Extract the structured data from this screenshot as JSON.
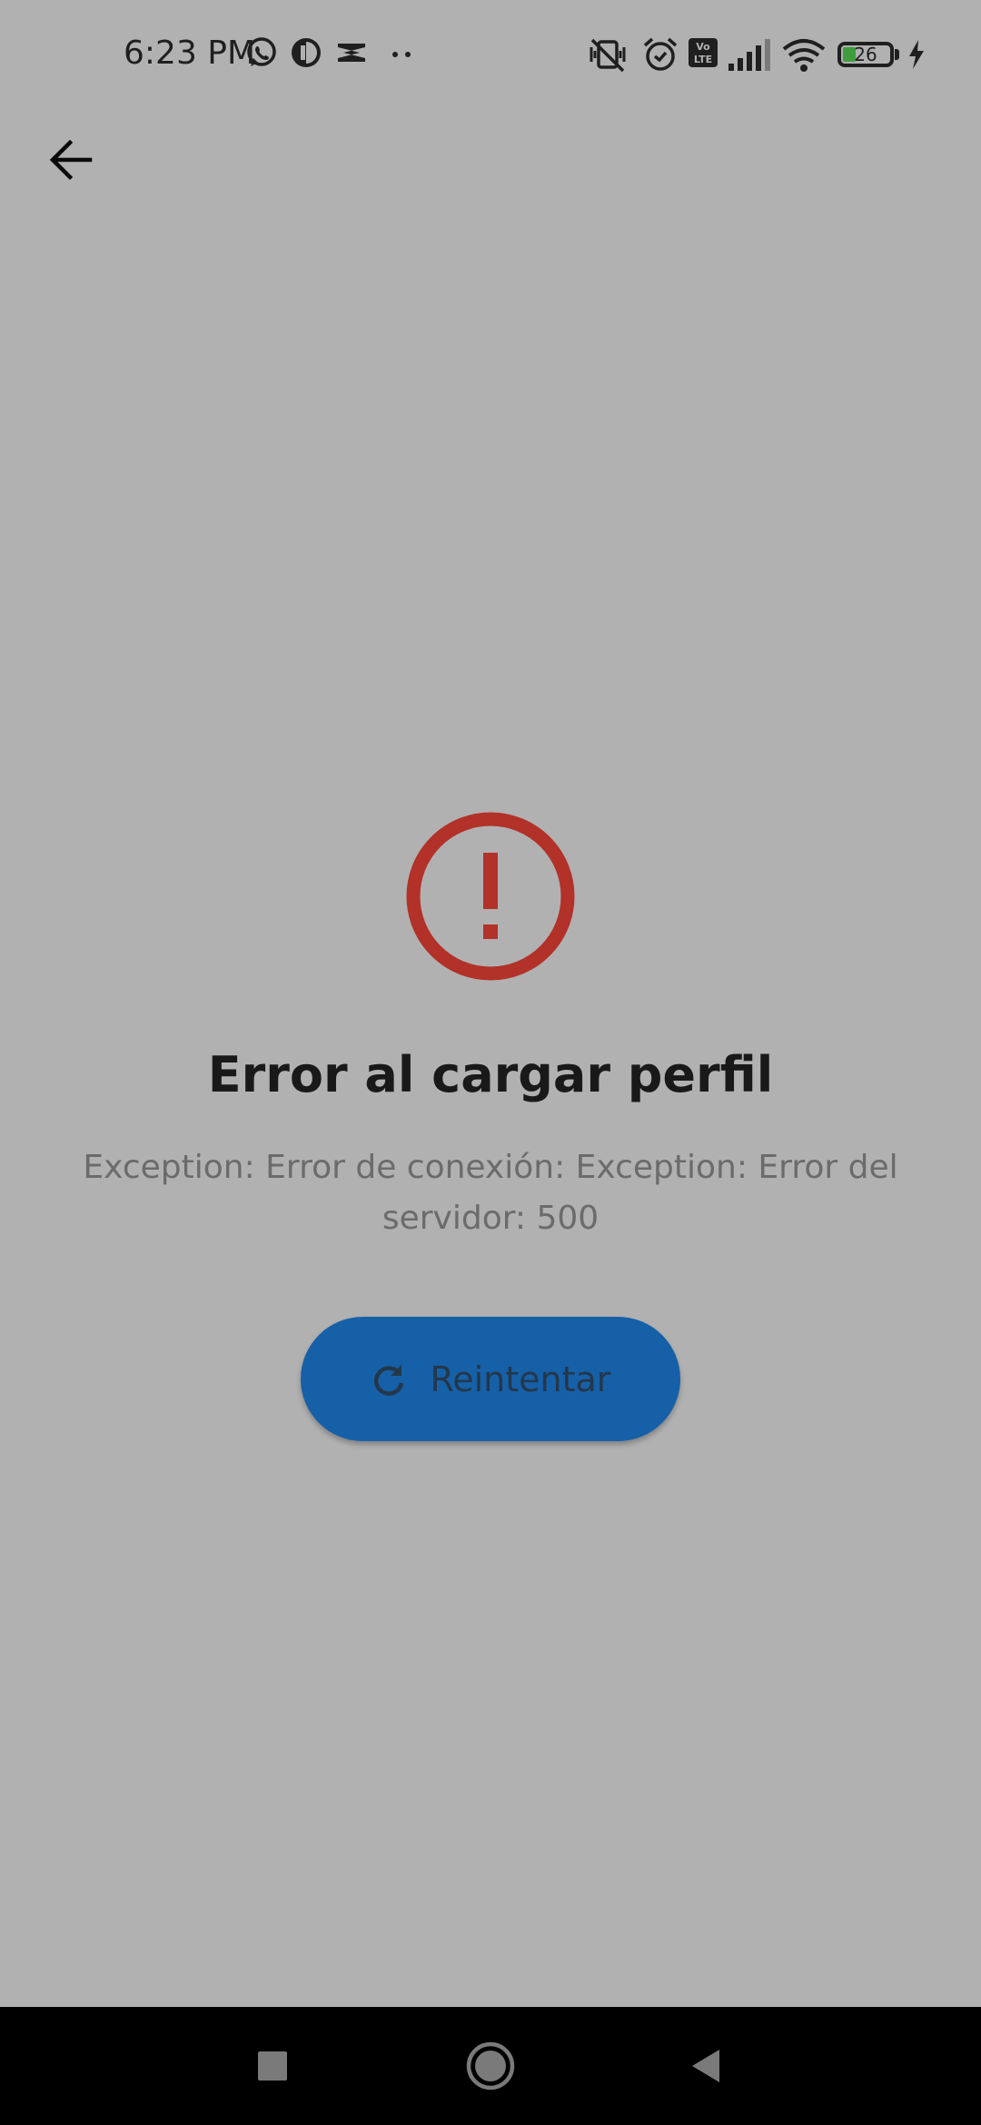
{
  "status_bar": {
    "time": "6:23 PM",
    "battery_level": "26",
    "icons": [
      "whatsapp-icon",
      "app-icon",
      "capcut-icon",
      "more-notifications-icon",
      "vibrate-off-icon",
      "alarm-icon",
      "volte-icon",
      "signal-icon",
      "wifi-icon",
      "battery-icon",
      "charging-icon"
    ],
    "volte_text": "Vo LTE"
  },
  "app_bar": {
    "back_icon": "arrow-left-icon"
  },
  "error": {
    "icon": "error-circle-icon",
    "icon_color": "#b23128",
    "title": "Error al cargar perfil",
    "message": "Exception: Error de conexión: Exception: Error del servidor: 500"
  },
  "retry_button": {
    "label": "Reintentar",
    "icon": "refresh-icon",
    "color": "#1660a8"
  },
  "nav_bar": {
    "items": [
      "recents-button",
      "home-button",
      "back-button"
    ]
  }
}
